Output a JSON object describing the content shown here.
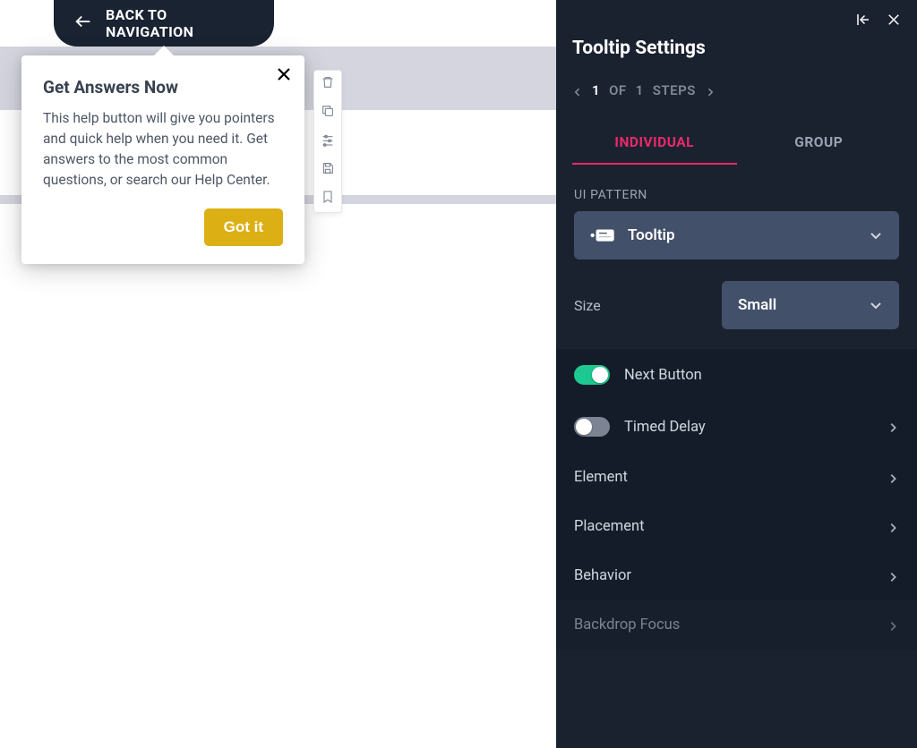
{
  "header": {
    "back_label": "BACK TO NAVIGATION"
  },
  "tooltip": {
    "title": "Get Answers Now",
    "body": "This help button will give you pointers and quick help when you need it. Get answers to the most common questions, or search our Help Center.",
    "cta": "Got it"
  },
  "panel": {
    "title": "Tooltip Settings",
    "steps": {
      "current": "1",
      "of_label": "OF",
      "total": "1",
      "steps_label": "STEPS"
    },
    "tabs": {
      "individual": "INDIVIDUAL",
      "group": "GROUP",
      "active": "individual"
    },
    "ui_pattern": {
      "label": "UI PATTERN",
      "value": "Tooltip"
    },
    "size": {
      "label": "Size",
      "value": "Small"
    },
    "rows": {
      "next_button": {
        "label": "Next Button",
        "toggle": true
      },
      "timed_delay": {
        "label": "Timed Delay",
        "toggle": false
      },
      "element": {
        "label": "Element"
      },
      "placement": {
        "label": "Placement"
      },
      "behavior": {
        "label": "Behavior"
      },
      "backdrop_focus": {
        "label": "Backdrop Focus"
      }
    }
  }
}
